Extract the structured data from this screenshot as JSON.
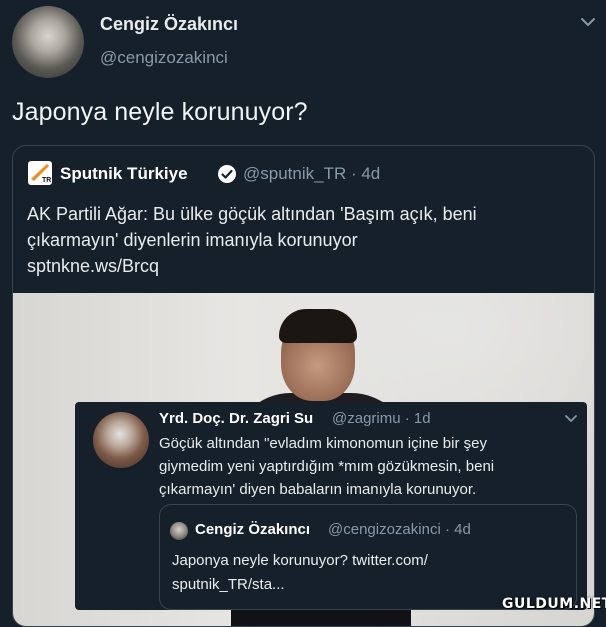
{
  "tweet": {
    "author_name": "Cengiz Özakıncı",
    "author_handle": "@cengizozakinci",
    "text": "Japonya neyle korunuyor?"
  },
  "quoted": {
    "author_name": "Sputnik Türkiye",
    "author_handle": "@sputnik_TR · 4d",
    "logo_text": "TR",
    "text": "AK Partili Ağar: Bu ülke göçük altından 'Başım açık, beni\nçıkarmayın' diyenlerin imanıyla korunuyor\nsptnkne.ws/Brcq"
  },
  "reply_overlay": {
    "author_name": "Yrd. Doç. Dr. Zagri Su",
    "author_handle": "@zagrimu · 1d",
    "text": "Göçük altından \"evladım kimonomun içine bir şey\ngiymedim yeni yaptırdığım *mım gözükmesin, beni\nçıkarmayın' diyen babaların imanıyla korunuyor.",
    "nested": {
      "author_name": "Cengiz Özakıncı",
      "author_handle": "@cengizozakinci · 4d",
      "text": "Japonya neyle korunuyor? twitter.com/\nsputnik_TR/sta..."
    }
  },
  "watermark": "GULDUM.NET",
  "colors": {
    "background": "#15202b",
    "secondary_text": "#8899a6",
    "border": "#38444d",
    "verified": "#ffffff",
    "sputnik_orange": "#f08b1d"
  },
  "icons": {
    "main_menu": "chevron-down-icon",
    "verified": "verified-badge-icon",
    "reply_menu": "chevron-down-icon"
  }
}
